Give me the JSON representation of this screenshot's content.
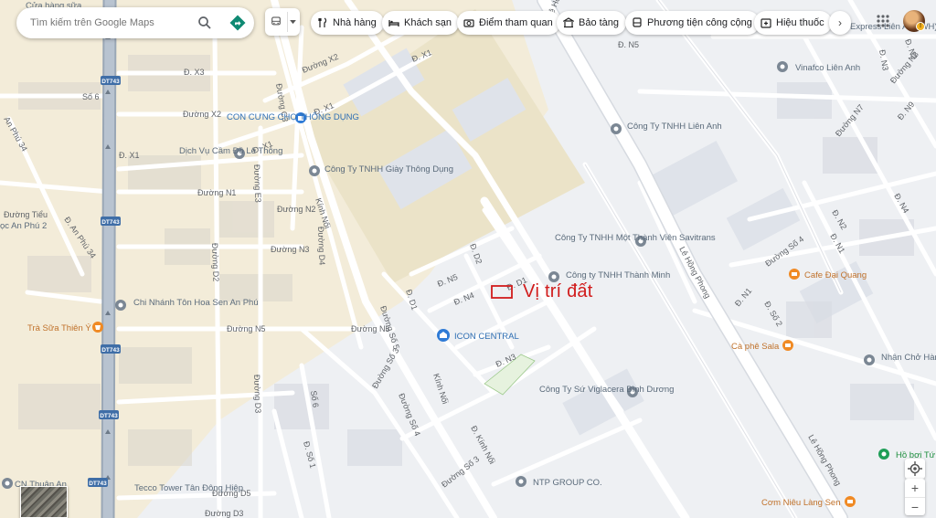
{
  "search": {
    "placeholder": "Tìm kiếm trên Google Maps"
  },
  "chips": [
    {
      "label": "Nhà hàng",
      "icon": "fork-knife-icon"
    },
    {
      "label": "Khách sạn",
      "icon": "bed-icon"
    },
    {
      "label": "Điểm tham quan",
      "icon": "camera-icon"
    },
    {
      "label": "Bảo tàng",
      "icon": "museum-icon"
    },
    {
      "label": "Phương tiện công cộng",
      "icon": "bus-icon"
    },
    {
      "label": "Hiệu thuốc",
      "icon": "pharmacy-icon"
    }
  ],
  "chip_next": "›",
  "site_marker": {
    "label": "Vị trí đất",
    "color": "#d11c1c"
  },
  "zoom": {
    "in": "+",
    "out": "−"
  },
  "highways": [
    "DT743",
    "DT743",
    "DT743",
    "DT743",
    "DT743"
  ],
  "roads": {
    "dx3": "Đ. X3",
    "x2a": "Đường X2",
    "x2b": "Đường X2",
    "x1a": "Đ. X1",
    "x1b": "Đ. X1",
    "x1c": "Đ. X1",
    "x1d": "Đ. X1",
    "c3": "Đường C3",
    "so6a": "Số 6",
    "anphu34a": "An Phú 34",
    "anphu34b": "Đ. An Phú 34",
    "n1": "Đường N1",
    "e3": "Đường E3",
    "n2": "Đường N2",
    "n3": "Đường N3",
    "d4": "Đường D4",
    "kinhnoi1": "Kính Nối",
    "d2": "Đường D2",
    "n5": "Đường N5",
    "n5b": "Đường N5",
    "d3": "Đường D3",
    "d5": "Đường D5",
    "d3b": "Đường D3",
    "dn5": "Đ. N5",
    "dd2": "Đ. D2",
    "dd1": "Đ. D1",
    "dn4": "Đ. N4",
    "dn3": "Đ. N3",
    "so5": "Đường Số 5",
    "so3": "Đường Số 3",
    "so4": "Đường Số 4",
    "kinhnoi2": "Kính Nối",
    "dkinhnoi": "Đ. Kính Nối",
    "so3b": "Đường Số 3",
    "so6b": "Số 6",
    "dso1": "Đ. Số 1",
    "lehongphong1": "Lê Hồng Phong",
    "lehongphong2": "Lê Hồng Phong",
    "lehongphong3": "Lê Hồng Phong",
    "dn5b": "Đ. N5",
    "n3b": "Đ. N3",
    "n2b": "Đ. N2",
    "n8": "Đường N8",
    "n9": "Đ. N9",
    "n7": "Đường N7",
    "n2c": "Đ. N2",
    "n1b": "Đ. N1",
    "n4": "Đ. N4",
    "so4b": "Đường Số 4",
    "so2": "Đ. Số 2",
    "dn1": "Đ. N1",
    "dd1b": "Đ. D1",
    "ltieu": "Đường Tiểu"
  },
  "pois": {
    "cuahangsua": "Cửa hàng sữa",
    "concung": "CON CƯNG CHỢ THÔNG DỤNG",
    "dichvucam": "Dịch Vụ Cầm Đồ Lê Thông",
    "giaythongdung": "Công Ty TNHH Giày Thông Dụng",
    "chinhanhton": "Chi Nhánh Tôn Hoa Sen An Phú",
    "trasua": "Trà Sữa Thiên Ý",
    "anphu2": "ọc An Phú 2",
    "iconcentral": "ICON CENTRAL",
    "savitrans": "Công Ty TNHH Một Thành Viên Savitrans",
    "thanhminh": "Công ty TNHH Thành Minh",
    "lienanh": "Công Ty TNHH Liên Anh",
    "vinafco": "Vinafco Liên Anh",
    "express": "Express Liên Anh WH)",
    "viglacera": "Công Ty Sứ Viglacera Bình Dương",
    "ntp": "NTP GROUP CO.",
    "tecco": "Tecco Tower Tân Đông Hiệp",
    "cnthuanan": "CN Thuận An",
    "cafedaiquang": "Cafe Đại Quang",
    "caphesala": "Cà phê Sala",
    "nhanchohang": "Nhận Chở Hàn xe tải-Chuyển",
    "hoboi": "Hồ bơi Tứ",
    "comnieu": "Cơm Niêu Làng Sen"
  }
}
